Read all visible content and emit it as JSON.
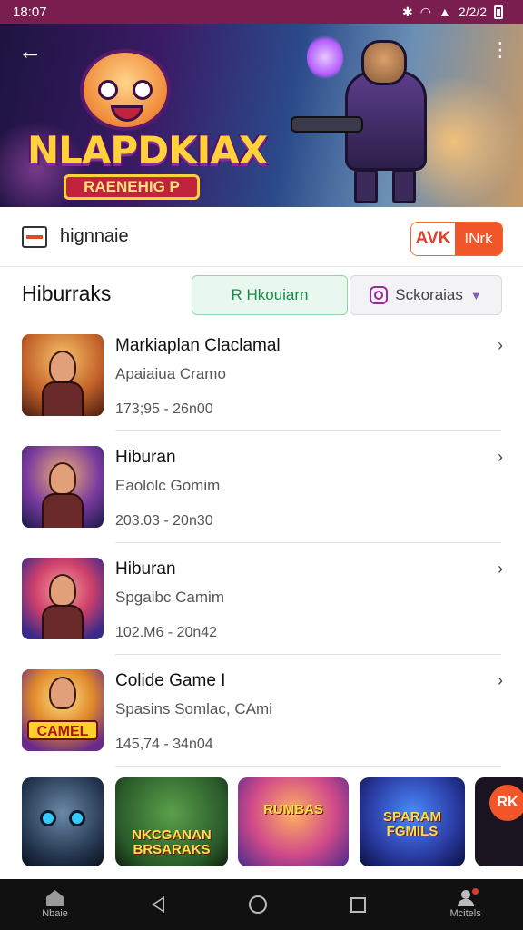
{
  "status_bar": {
    "time": "18:07",
    "right_text": "2/2/2"
  },
  "banner": {
    "logo_title": "NLAPDKIAX",
    "logo_subtitle": "RAENEHIG P"
  },
  "app_row": {
    "name": "hignnaie",
    "toggle_left": "AVK",
    "toggle_right": "INrk"
  },
  "section": {
    "title": "Hiburraks",
    "tab_primary": "R Hkouiarn",
    "tab_secondary": "Sckoraias"
  },
  "list": [
    {
      "title": "Markiaplan Claclamal",
      "subtitle": "Apaiaiua Cramo",
      "meta": "173;95 - 26n00"
    },
    {
      "title": "Hiburan",
      "subtitle": "Eaololc Gomim",
      "meta": "203.03 - 20n30"
    },
    {
      "title": "Hiburan",
      "subtitle": "Spgaibc Camim",
      "meta": "102.M6 - 20n42"
    },
    {
      "title": "Colide Game I",
      "subtitle": "Spasins Somlac, CAmi",
      "meta": "145,74 - 34n04",
      "thumb_caption": "CAMEL"
    }
  ],
  "carousel": {
    "card2_text": "NKCGANAN BRSARAKS",
    "card3_text": "RUMBAS",
    "card4_text": "SPARAM FGMILS",
    "card5_badge": "RK"
  },
  "navbar": {
    "home_label": "Nbaie",
    "user_label": "Mcitels"
  },
  "colors": {
    "status_bar": "#7a1e4f",
    "accent": "#f2552a",
    "tab_primary": "#1a8a4a"
  }
}
